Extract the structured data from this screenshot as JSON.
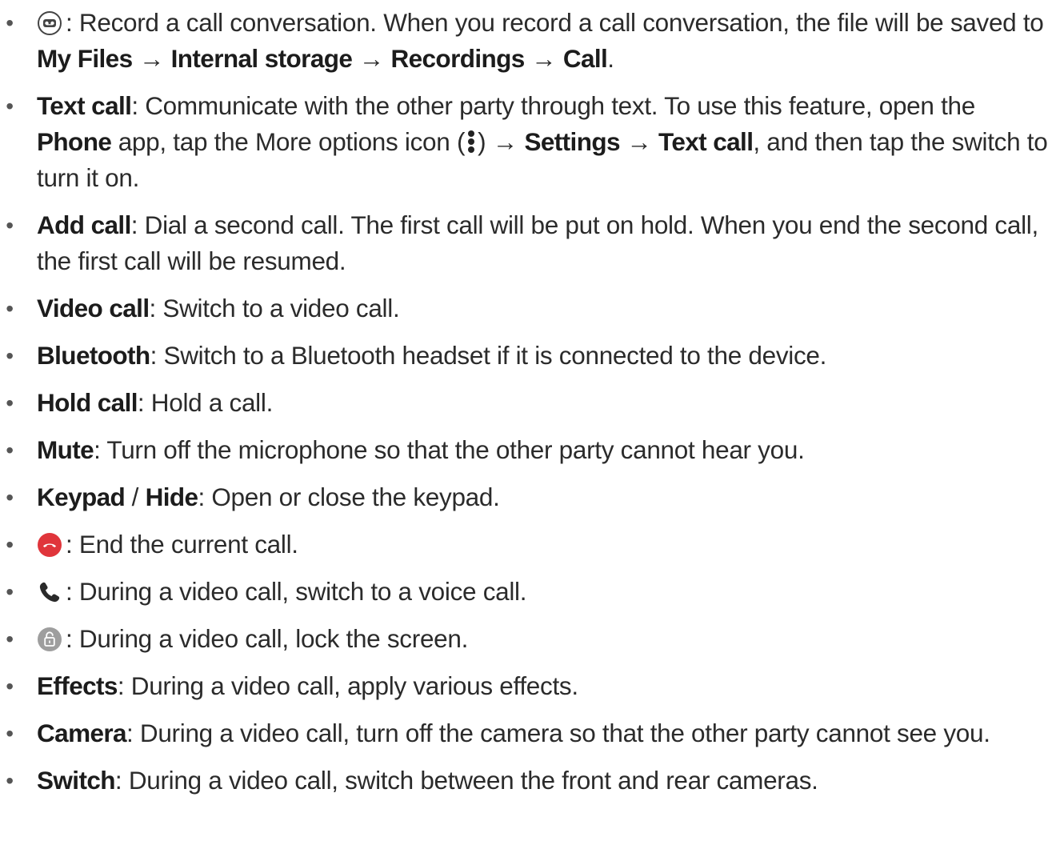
{
  "items": [
    {
      "icon": "record-icon",
      "desc1": ": Record a call conversation. When you record a call conversation, the file will be saved to ",
      "path": [
        "My Files",
        "Internal storage",
        "Recordings",
        "Call"
      ],
      "arrow": "→",
      "end": "."
    },
    {
      "term": "Text call",
      "desc1": ": Communicate with the other party through text. To use this feature, open the ",
      "phone": "Phone",
      "desc2": " app, tap the More options icon (",
      "desc3": ") ",
      "settings": "Settings",
      "textcall": "Text call",
      "desc4": ", and then tap the switch to turn it on."
    },
    {
      "term": "Add call",
      "desc": ": Dial a second call. The first call will be put on hold. When you end the second call, the first call will be resumed."
    },
    {
      "term": "Video call",
      "desc": ": Switch to a video call."
    },
    {
      "term": "Bluetooth",
      "desc": ": Switch to a Bluetooth headset if it is connected to the device."
    },
    {
      "term": "Hold call",
      "desc": ": Hold a call."
    },
    {
      "term": "Mute",
      "desc": ": Turn off the microphone so that the other party cannot hear you."
    },
    {
      "term": "Keypad",
      "sep": " / ",
      "term2": "Hide",
      "desc": ": Open or close the keypad."
    },
    {
      "icon": "end-call-icon",
      "desc": ": End the current call."
    },
    {
      "icon": "voice-call-icon",
      "desc": ": During a video call, switch to a voice call."
    },
    {
      "icon": "lock-screen-icon",
      "desc": ": During a video call, lock the screen."
    },
    {
      "term": "Effects",
      "desc": ": During a video call, apply various effects."
    },
    {
      "term": "Camera",
      "desc": ": During a video call, turn off the camera so that the other party cannot see you."
    },
    {
      "term": "Switch",
      "desc": ": During a video call, switch between the front and rear cameras."
    }
  ],
  "bullet": "•",
  "colors": {
    "end_call_red": "#e0353b",
    "lock_grey": "#9e9e9e",
    "text": "#2b2b2b"
  }
}
